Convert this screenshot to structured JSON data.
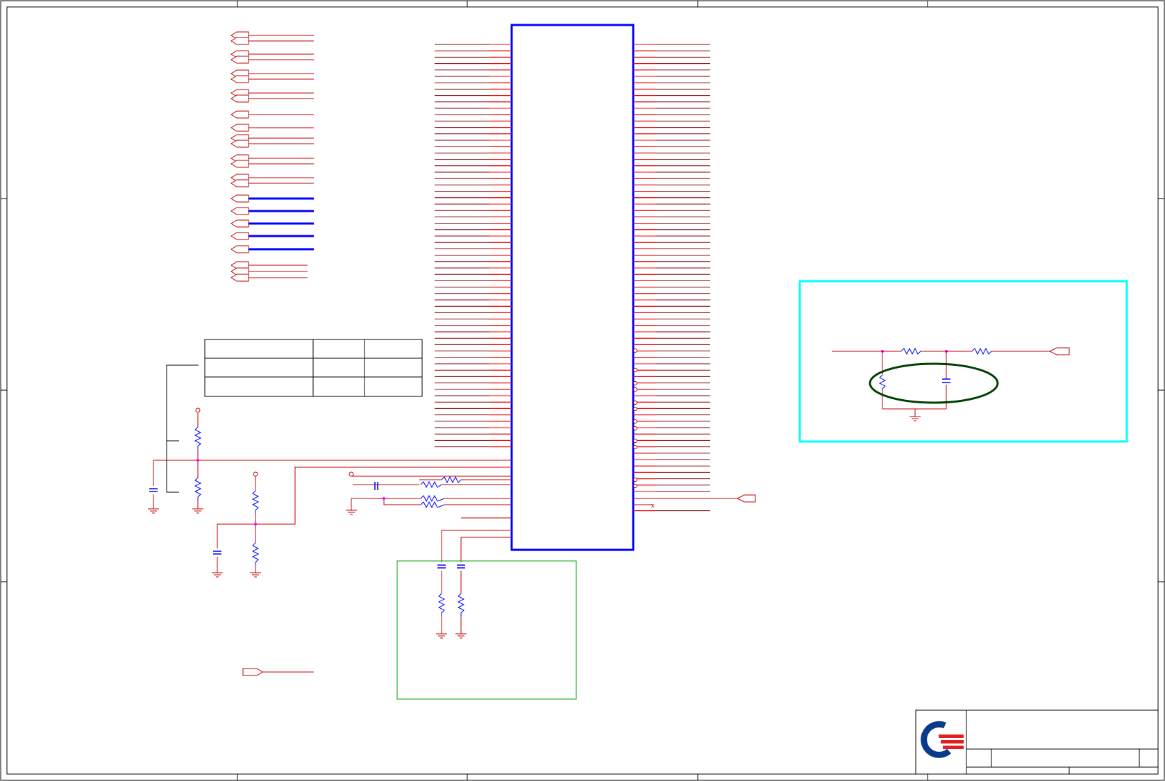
{
  "sheet": {
    "background": "#ffffff",
    "border_color": "#000000"
  },
  "colors": {
    "wire": "#c00000",
    "net_label": "#ff0000",
    "pin_dark": "#800000",
    "bus": "#0000ff",
    "ic_body": "#0000ff",
    "junction": "#ff00ff",
    "crossover_wire": "#a000a0",
    "resistor": "#0000ff",
    "capacitor": "#0000ff",
    "highlight_box": "#00ffff",
    "highlight_ellipse": "#004000",
    "note_box": "#00a000",
    "logo_blue": "#0a3a8c",
    "logo_red": "#e02020"
  },
  "icons": {
    "logo": "company-logo-icon",
    "ground": "ground-icon",
    "power": "power-pin-icon",
    "resistor": "resistor-icon",
    "capacitor": "capacitor-icon",
    "offpage": "offpage-connector-icon"
  },
  "title_block": {
    "title": "",
    "doc_number": "",
    "rev": "",
    "sheet": ""
  },
  "table": {
    "rows": 3,
    "cols": 3
  }
}
